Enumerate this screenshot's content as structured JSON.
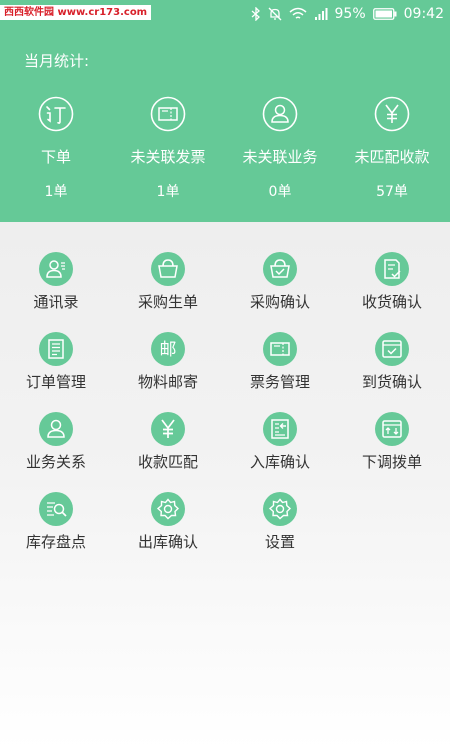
{
  "status_bar": {
    "watermark": "西西软件园 www.cr173.com",
    "battery": "95%",
    "time": "09:42"
  },
  "stats": {
    "title": "当月统计:",
    "items": [
      {
        "icon": "ding-icon",
        "label": "下单",
        "value": "1单"
      },
      {
        "icon": "invoice-icon",
        "label": "未关联发票",
        "value": "1单"
      },
      {
        "icon": "person-icon",
        "label": "未关联业务",
        "value": "0单"
      },
      {
        "icon": "yen-icon",
        "label": "未匹配收款",
        "value": "57单"
      }
    ]
  },
  "menu": {
    "items": [
      {
        "icon": "contacts-icon",
        "label": "通讯录"
      },
      {
        "icon": "basket-icon",
        "label": "采购生单"
      },
      {
        "icon": "basket-check-icon",
        "label": "采购确认"
      },
      {
        "icon": "receipt-check-icon",
        "label": "收货确认"
      },
      {
        "icon": "order-list-icon",
        "label": "订单管理"
      },
      {
        "icon": "mail-char-icon",
        "label": "物料邮寄"
      },
      {
        "icon": "ticket-icon",
        "label": "票务管理"
      },
      {
        "icon": "delivery-check-icon",
        "label": "到货确认"
      },
      {
        "icon": "person-icon",
        "label": "业务关系"
      },
      {
        "icon": "yen-icon",
        "label": "收款匹配"
      },
      {
        "icon": "warehouse-in-icon",
        "label": "入库确认"
      },
      {
        "icon": "transfer-icon",
        "label": "下调拨单"
      },
      {
        "icon": "inventory-search-icon",
        "label": "库存盘点"
      },
      {
        "icon": "gear-icon",
        "label": "出库确认"
      },
      {
        "icon": "gear-icon",
        "label": "设置"
      }
    ]
  },
  "colors": {
    "header": "#65c997",
    "icon_bg": "#66c998"
  }
}
